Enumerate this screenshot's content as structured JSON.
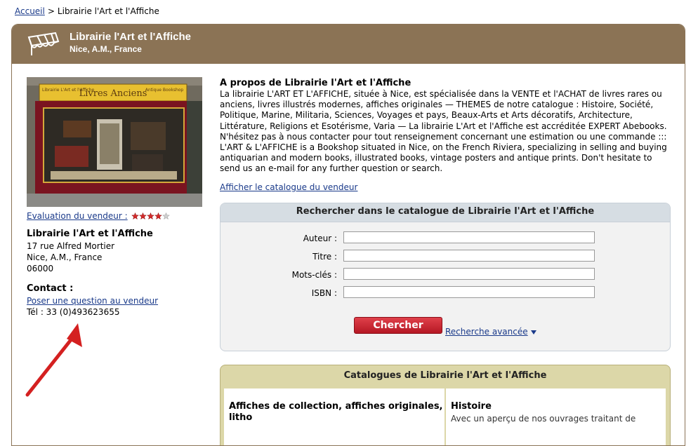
{
  "breadcrumb": {
    "home": "Accueil",
    "sep": ">",
    "current": "Librairie l'Art et l'Affiche"
  },
  "header": {
    "title": "Librairie l'Art et l'Affiche",
    "location": "Nice, A.M., France",
    "color": "#8b7355"
  },
  "seller": {
    "rating_label": "Evaluation du vendeur :",
    "rating_stars": 4,
    "name": "Librairie l'Art et l'Affiche",
    "address": [
      "17 rue Alfred Mortier",
      "Nice, A.M., France",
      "06000"
    ],
    "contact_title": "Contact :",
    "contact_link": "Poser une question au vendeur",
    "phone": "Tél : 33 (0)493623655"
  },
  "photo": {
    "sign_left": "Librairie L'Art et l'Affiche",
    "sign_center": "Livres Anciens",
    "sign_right": "Antique Bookshop"
  },
  "about": {
    "title": "A propos de Librairie l'Art et l'Affiche",
    "text": "La librairie L'ART ET L'AFFICHE, située à Nice, est spécialisée dans la VENTE et l'ACHAT de livres rares ou anciens, livres illustrés modernes, affiches originales — THEMES de notre catalogue : Histoire, Société, Politique, Marine, Militaria, Sciences, Voyages et pays, Beaux-Arts et Arts décoratifs, Architecture, Littérature, Religions et Esotérisme, Varia — La librairie L'Art et l'Affiche est accréditée EXPERT Abebooks. N'hésitez pas à nous contacter pour tout renseignement concernant une estimation ou une commande ::: L'ART & L'AFFICHE is a Bookshop situated in Nice, on the French Riviera, specializing in selling and buying antiquarian and modern books, illustrated books, vintage posters and antique prints. Don't hesitate to send us an e-mail for any further question or search.",
    "catalog_link": "Afficher le catalogue du vendeur"
  },
  "search": {
    "title": "Rechercher dans le catalogue de Librairie l'Art et l'Affiche",
    "fields": [
      {
        "label": "Auteur :",
        "value": ""
      },
      {
        "label": "Titre :",
        "value": ""
      },
      {
        "label": "Mots-clés :",
        "value": ""
      },
      {
        "label": "ISBN :",
        "value": ""
      }
    ],
    "button": "Chercher",
    "advanced": "Recherche avancée"
  },
  "catalogs": {
    "title": "Catalogues de Librairie l'Art et l'Affiche",
    "items": [
      {
        "title": "Affiches de collection, affiches originales, litho",
        "desc": ""
      },
      {
        "title": "Histoire",
        "desc": "Avec un aperçu de nos ouvrages traitant de"
      }
    ]
  }
}
